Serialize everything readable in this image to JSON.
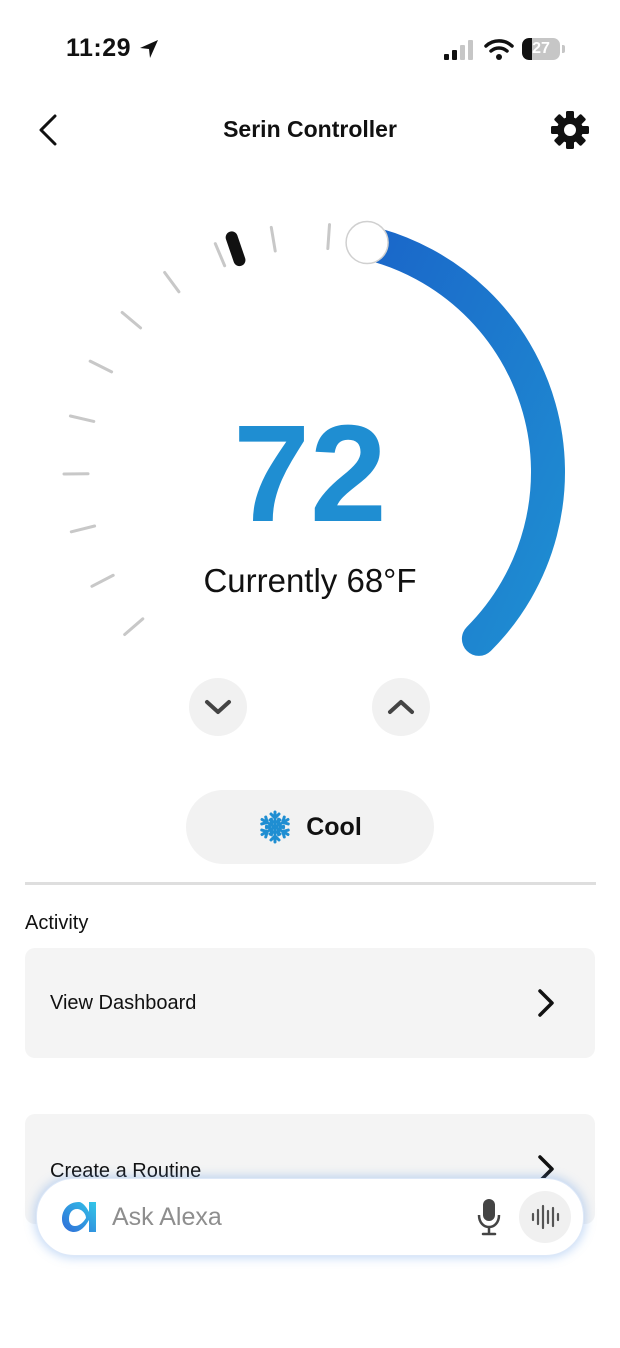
{
  "status_bar": {
    "time": "11:29",
    "battery_level": "27",
    "battery_fraction": 0.27,
    "icons": [
      "location-arrow-icon",
      "signal-icon",
      "wifi-icon",
      "battery-icon"
    ]
  },
  "nav": {
    "title": "Serin Controller",
    "back_icon": "chevron-left-icon",
    "settings_icon": "gear-icon"
  },
  "thermostat": {
    "setpoint": "72",
    "current_label": "Currently 68°F",
    "accent_color": "#1f8ed2",
    "arc_color_start": "#1a66c9",
    "setpoint_fraction": 0.55,
    "current_fraction": 0.43,
    "decrease_icon": "chevron-down-icon",
    "increase_icon": "chevron-up-icon"
  },
  "mode": {
    "label": "Cool",
    "icon": "snowflake-icon",
    "icon_color": "#1f8ed2"
  },
  "activity": {
    "section_label": "Activity",
    "items": [
      {
        "label": "View Dashboard",
        "icon": "chevron-right-icon"
      },
      {
        "label": "Create a Routine",
        "icon": "chevron-right-icon"
      }
    ]
  },
  "alexa": {
    "placeholder": "Ask Alexa",
    "logo_icon": "alexa-logo-icon",
    "mic_icon": "microphone-icon",
    "voice_icon": "sound-wave-icon"
  }
}
